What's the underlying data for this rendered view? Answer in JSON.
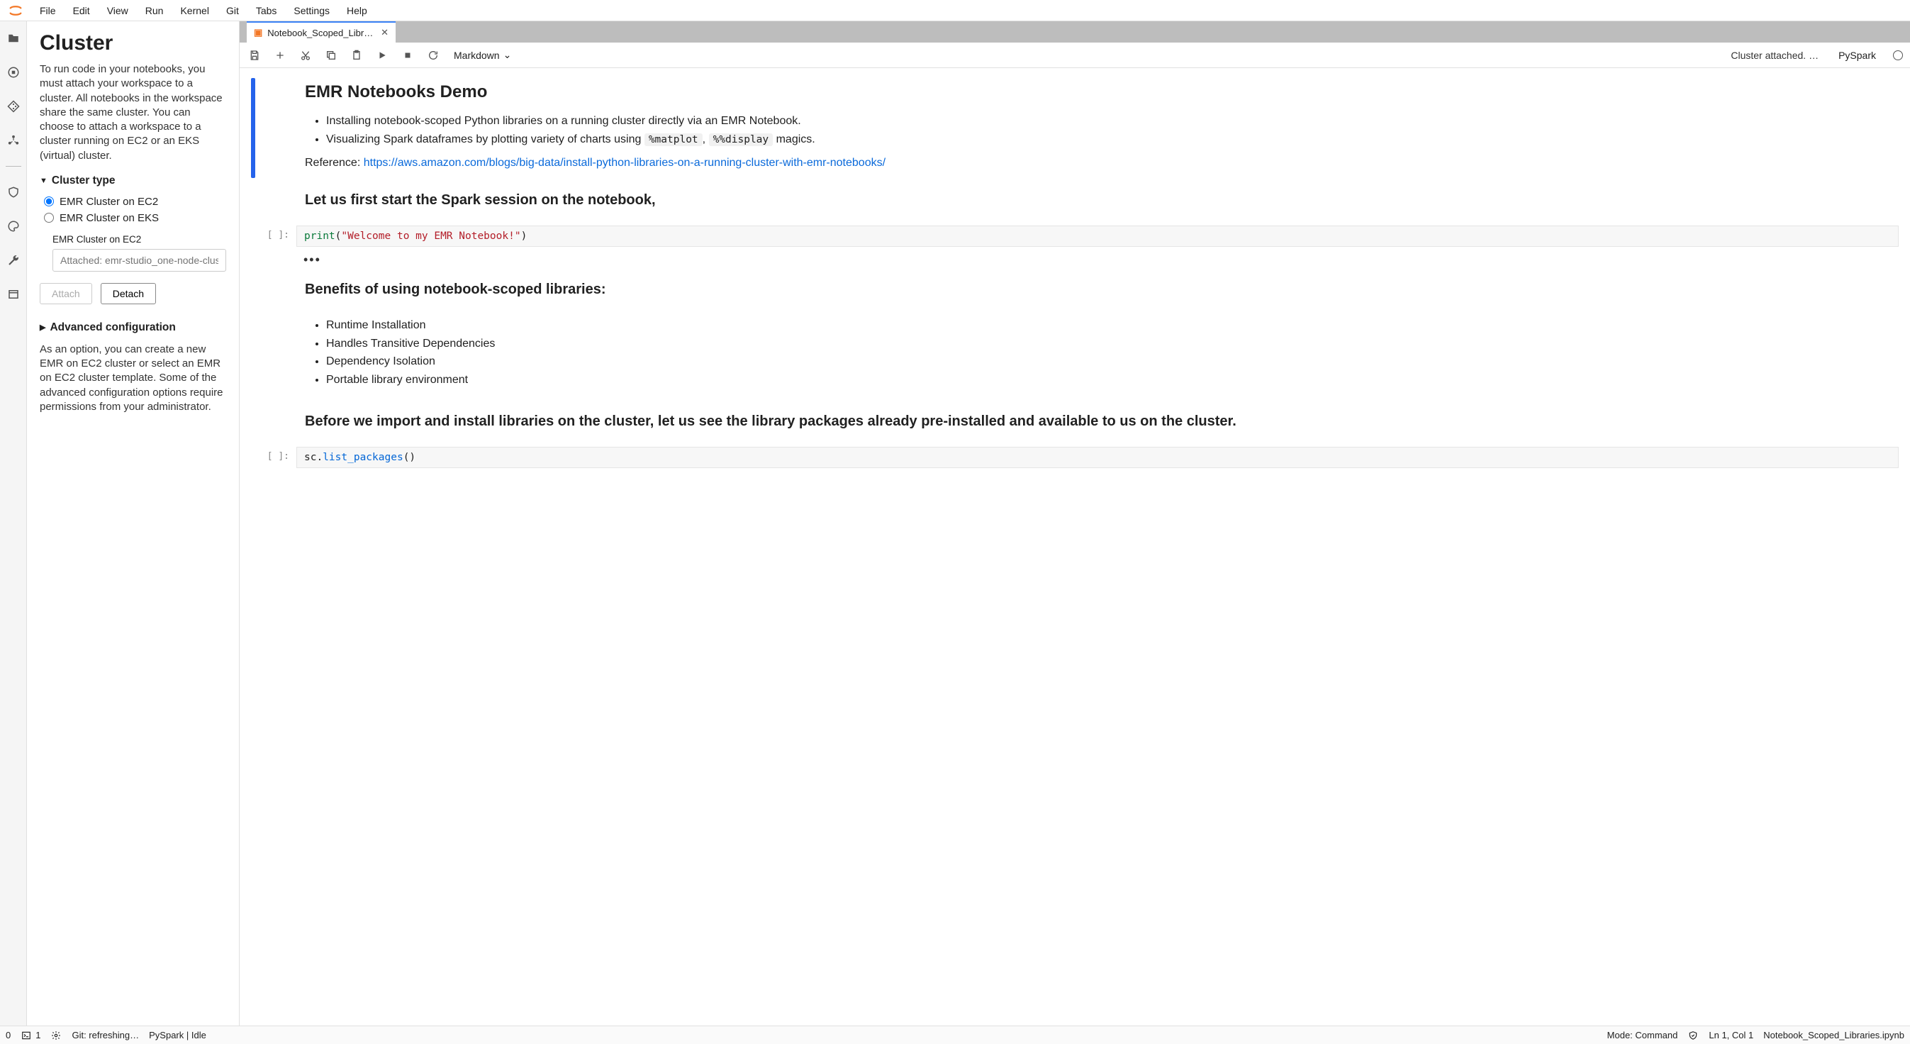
{
  "menubar": {
    "items": [
      "File",
      "Edit",
      "View",
      "Run",
      "Kernel",
      "Git",
      "Tabs",
      "Settings",
      "Help"
    ]
  },
  "activity_bar": {
    "items": [
      {
        "name": "folder-icon"
      },
      {
        "name": "stop-circle-icon"
      },
      {
        "name": "git-icon"
      },
      {
        "name": "cluster-icon"
      }
    ],
    "items2": [
      {
        "name": "shield-icon"
      },
      {
        "name": "palette-icon"
      },
      {
        "name": "wrench-icon"
      },
      {
        "name": "window-icon"
      }
    ]
  },
  "side_panel": {
    "title": "Cluster",
    "desc": "To run code in your notebooks, you must attach your workspace to a cluster. All notebooks in the workspace share the same cluster. You can choose to attach a workspace to a cluster running on EC2 or an EKS (virtual) cluster.",
    "cluster_type_label": "Cluster type",
    "radio_ec2": "EMR Cluster on EC2",
    "radio_eks": "EMR Cluster on EKS",
    "sub_label": "EMR Cluster on EC2",
    "attach_placeholder": "Attached: emr-studio_one-node-cluster_",
    "attach_btn": "Attach",
    "detach_btn": "Detach",
    "adv_label": "Advanced configuration",
    "adv_desc": "As an option, you can create a new EMR on EC2 cluster or select an EMR on EC2 cluster template. Some of the advanced configuration options require permissions from your administrator."
  },
  "tab": {
    "title": "Notebook_Scoped_Librarie"
  },
  "toolbar": {
    "cell_type": "Markdown",
    "status": "Cluster attached. …",
    "kernel": "PySpark"
  },
  "notebook": {
    "md1_title": "EMR Notebooks Demo",
    "md1_li1": "Installing notebook-scoped Python libraries on a running cluster directly via an EMR Notebook.",
    "md1_li2_a": "Visualizing Spark dataframes by plotting variety of charts using ",
    "md1_li2_code1": "%matplot",
    "md1_li2_b": ", ",
    "md1_li2_code2": "%%display",
    "md1_li2_c": " magics.",
    "md1_ref_label": "Reference: ",
    "md1_ref_link": "https://aws.amazon.com/blogs/big-data/install-python-libraries-on-a-running-cluster-with-emr-notebooks/",
    "md2_title": "Let us first start the Spark session on the notebook,",
    "code1_prompt": "[ ]:",
    "code1_fn": "print",
    "code1_open": "(",
    "code1_str": "\"Welcome to my EMR Notebook!\"",
    "code1_close": ")",
    "out1": "•••",
    "md3_title": "Benefits of using notebook-scoped libraries:",
    "md3_items": [
      "Runtime Installation",
      "Handles Transitive Dependencies",
      "Dependency Isolation",
      "Portable library environment"
    ],
    "md4_title": "Before we import and install libraries on the cluster, let us see the library packages already pre-installed and available to us on the cluster.",
    "code2_prompt": "[ ]:",
    "code2_obj": "sc.",
    "code2_fn": "list_packages",
    "code2_paren": "()"
  },
  "status_bar": {
    "left_count": "0",
    "term_count": "1",
    "git_status": "Git: refreshing…",
    "kernel": "PySpark | Idle",
    "mode": "Mode: Command",
    "lncol": "Ln 1, Col 1",
    "filename": "Notebook_Scoped_Libraries.ipynb"
  }
}
